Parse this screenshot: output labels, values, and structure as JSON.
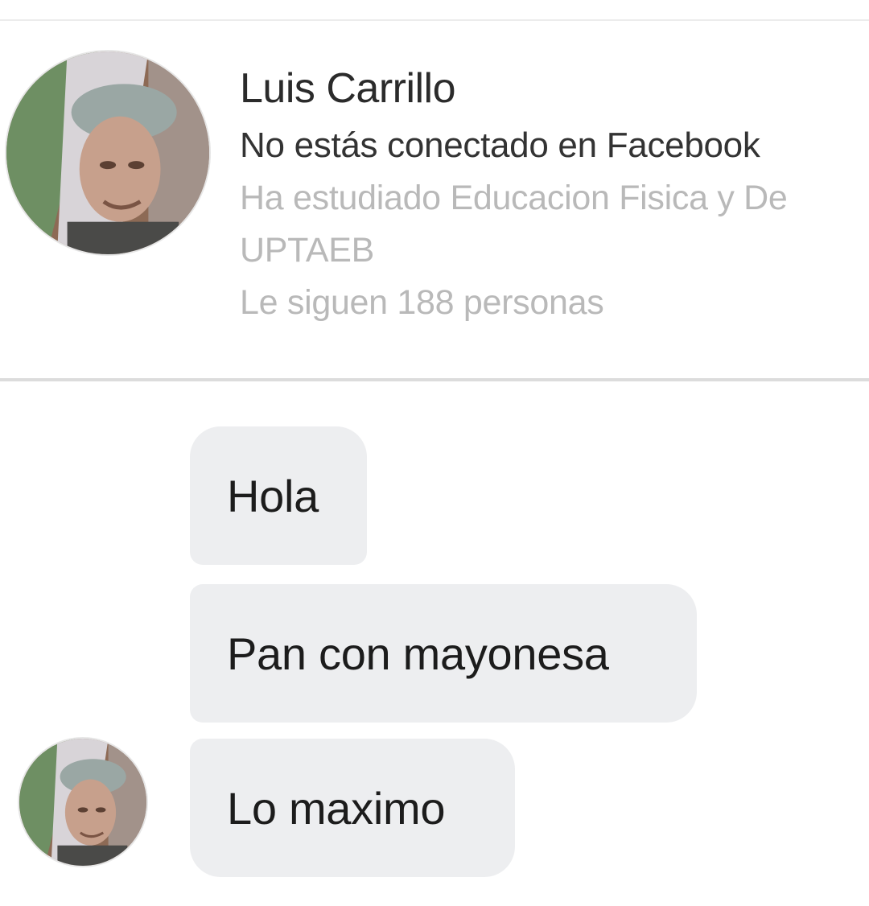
{
  "profile": {
    "name": "Luis Carrillo",
    "status": "No estás conectado en Facebook",
    "education_line1": "Ha estudiado Educacion Fisica y De",
    "education_line2": "UPTAEB",
    "followers": "Le siguen 188 personas",
    "avatar_icon": "profile-photo-icon"
  },
  "messages": [
    {
      "text": "Hola"
    },
    {
      "text": "Pan con mayonesa"
    },
    {
      "text": "Lo maximo"
    }
  ],
  "colors": {
    "bubble_bg": "#edeef0",
    "name_text": "#2b2b2b",
    "secondary_text": "#b9b9b9"
  }
}
